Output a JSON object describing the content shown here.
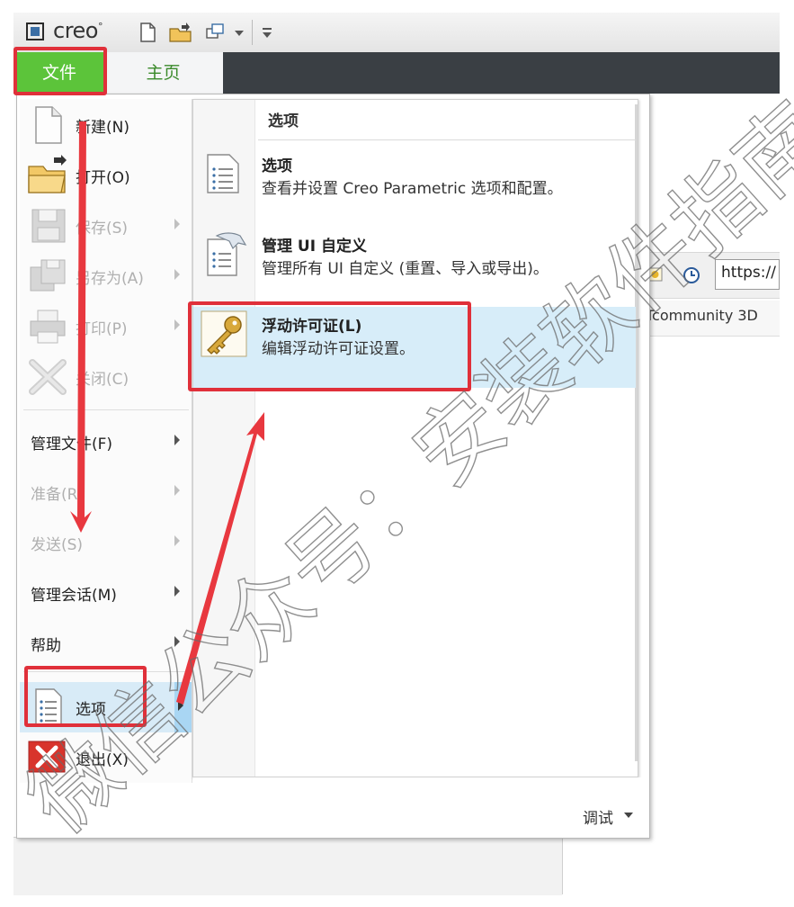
{
  "app": {
    "logo_text": "creo",
    "logo_trademark": "°"
  },
  "ribbon": {
    "file_tab": "文件",
    "home_tab": "主页"
  },
  "background": {
    "url": "https://",
    "site_text": "Tcommunity 3D"
  },
  "file_menu": {
    "items": [
      {
        "label": "新建(N)",
        "icon": "new-document-icon",
        "enabled": true,
        "submenu": false
      },
      {
        "label": "打开(O)",
        "icon": "open-folder-icon",
        "enabled": true,
        "submenu": false
      },
      {
        "label": "保存(S)",
        "icon": "save-disk-icon",
        "enabled": false,
        "submenu": true
      },
      {
        "label": "另存为(A)",
        "icon": "save-as-icon",
        "enabled": false,
        "submenu": true
      },
      {
        "label": "打印(P)",
        "icon": "printer-icon",
        "enabled": false,
        "submenu": true
      },
      {
        "label": "关闭(C)",
        "icon": "close-x-icon",
        "enabled": false,
        "submenu": false
      },
      {
        "label": "管理文件(F)",
        "enabled": true,
        "submenu": true
      },
      {
        "label": "准备(R)",
        "enabled": false,
        "submenu": true
      },
      {
        "label": "发送(S)",
        "enabled": false,
        "submenu": true
      },
      {
        "label": "管理会话(M)",
        "enabled": true,
        "submenu": true
      },
      {
        "label": "帮助",
        "enabled": true,
        "submenu": true
      },
      {
        "label": "选项",
        "icon": "options-list-icon",
        "enabled": true,
        "submenu": true,
        "selected": true
      },
      {
        "label": "退出(X)",
        "icon": "exit-red-x-icon",
        "enabled": true,
        "submenu": false
      }
    ]
  },
  "submenu": {
    "header": "选项",
    "items": [
      {
        "title": "选项",
        "description": "查看并设置 Creo Parametric 选项和配置。",
        "icon": "options-list-icon"
      },
      {
        "title": "管理 UI 自定义",
        "description": "管理所有 UI 自定义 (重置、导入或导出)。",
        "icon": "ui-customize-icon"
      },
      {
        "title": "浮动许可证(L)",
        "description": "编辑浮动许可证设置。",
        "icon": "key-icon",
        "highlighted": true
      }
    ]
  },
  "footer": {
    "debug_label": "调试"
  },
  "watermark": {
    "text": "微信公众号：安装软件指南"
  },
  "colors": {
    "file_tab": "#5cc43a",
    "ribbon": "#3a3f44",
    "highlight": "#d7edf9",
    "annotation_red": "#e0303a"
  }
}
